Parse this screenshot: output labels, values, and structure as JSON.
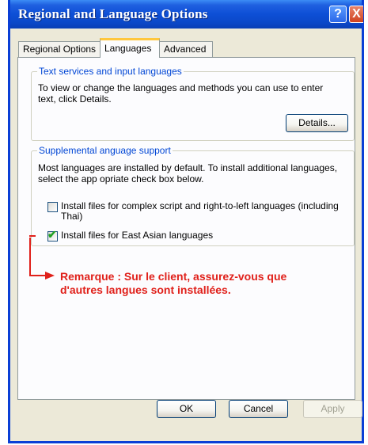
{
  "window": {
    "title": "Regional and Language Options",
    "help_glyph": "?",
    "close_glyph": "X"
  },
  "tabs": [
    {
      "label": "Regional Options",
      "active": false
    },
    {
      "label": "Languages",
      "active": true
    },
    {
      "label": "Advanced",
      "active": false
    }
  ],
  "text_services": {
    "legend": "Text services and input languages",
    "description_line1": "To view or change the languages and methods you can use to enter",
    "description_line2": "text, click Details.",
    "details_button": "Details..."
  },
  "supplemental": {
    "legend": "Supplemental anguage support",
    "description_line1": "Most languages are installed by default. To install additional languages,",
    "description_line2": "select the app opriate check box below.",
    "complex_script": {
      "label_line1": "Install files for complex script and right-to-left languages (including",
      "label_line2": "Thai)",
      "checked": false
    },
    "east_asian": {
      "label": "Install files for East Asian languages",
      "checked": true
    }
  },
  "annotation": {
    "line1": "Remarque : Sur le client, assurez-vous que",
    "line2": "d'autres langues sont installées.",
    "color": "#e0201a"
  },
  "footer": {
    "ok": "OK",
    "cancel": "Cancel",
    "apply": "Apply"
  },
  "colors": {
    "titlebar": "#0d4fd6",
    "legend": "#0046d5",
    "dialog": "#ece9d8",
    "active_tab_accent": "#ffc73c"
  }
}
